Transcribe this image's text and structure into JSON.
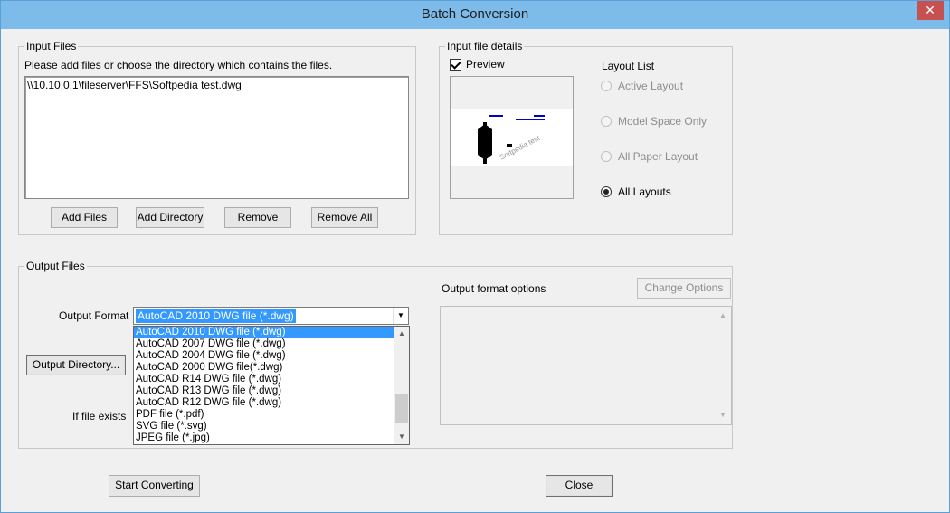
{
  "window": {
    "title": "Batch Conversion",
    "close_glyph": "✕"
  },
  "input_files": {
    "legend": "Input Files",
    "instruction": "Please add files or choose the directory which contains the files.",
    "files": [
      "\\\\10.10.0.1\\fileserver\\FFS\\Softpedia test.dwg"
    ],
    "buttons": {
      "add_files": "Add Files",
      "add_directory": "Add Directory",
      "remove": "Remove",
      "remove_all": "Remove All"
    }
  },
  "input_details": {
    "legend": "Input file details",
    "preview_label": "Preview",
    "preview_checked": true,
    "preview_watermark": "Softpedia test",
    "layout_list_label": "Layout List",
    "layouts": [
      {
        "label": "Active Layout",
        "enabled": false,
        "checked": false
      },
      {
        "label": "Model Space Only",
        "enabled": false,
        "checked": false
      },
      {
        "label": "All Paper Layout",
        "enabled": false,
        "checked": false
      },
      {
        "label": "All Layouts",
        "enabled": true,
        "checked": true
      }
    ]
  },
  "output_files": {
    "legend": "Output Files",
    "output_format_label": "Output Format",
    "output_format_value": "AutoCAD 2010 DWG file (*.dwg)",
    "output_directory_button": "Output Directory...",
    "if_file_exists_label": "If file exists",
    "format_options": [
      "AutoCAD 2010 DWG file (*.dwg)",
      "AutoCAD 2007 DWG file (*.dwg)",
      "AutoCAD 2004 DWG file (*.dwg)",
      "AutoCAD 2000 DWG file(*.dwg)",
      "AutoCAD R14 DWG file (*.dwg)",
      "AutoCAD R13 DWG file (*.dwg)",
      "AutoCAD R12 DWG file (*.dwg)",
      "PDF file (*.pdf)",
      "SVG file (*.svg)",
      "JPEG file (*.jpg)"
    ],
    "selected_index": 0,
    "output_format_options_label": "Output format options",
    "change_options_button": "Change Options"
  },
  "footer": {
    "start_button": "Start Converting",
    "close_button": "Close"
  }
}
